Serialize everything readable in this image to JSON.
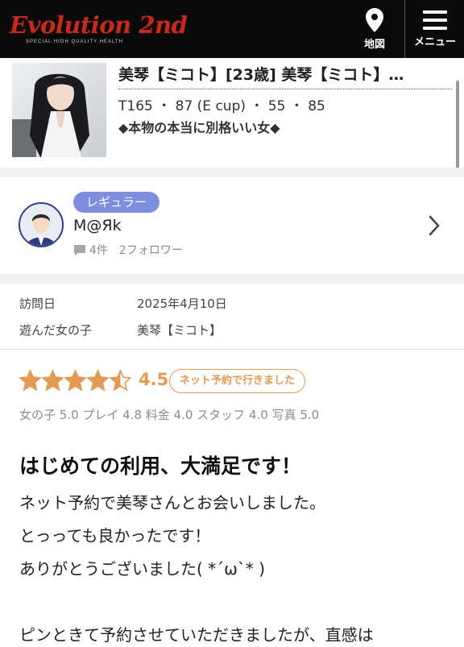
{
  "header": {
    "logo_main": "Evolution 2nd",
    "logo_sub": "SPECIAL HIGH QUALITY HEALTH",
    "map_icon": "map-pin-icon",
    "map_label": "地図",
    "menu_icon": "hamburger-menu-icon",
    "menu_label": "メニュー"
  },
  "cast": {
    "name": "美琴【ミコト】[23歳] 美琴【ミコト】…",
    "stats": "T165 ・ 87 (E cup) ・ 55 ・ 85",
    "catchphrase": "◆本物の本当に別格いい女◆"
  },
  "reviewer": {
    "badge": "レギュラー",
    "name": "M@Яk",
    "review_count": "4件",
    "followers": "2フォロワー"
  },
  "visit": {
    "date_label": "訪問日",
    "date_value": "2025年4月10日",
    "girl_label": "遊んだ女の子",
    "girl_value": "美琴【ミコト】"
  },
  "rating": {
    "score": "4.5",
    "score_value": 4.5,
    "stars_max": 5,
    "reservation_badge": "ネット予約で行きました",
    "subscores": "女の子 5.0 プレイ 4.8 料金 4.0 スタッフ 4.0 写真 5.0"
  },
  "review": {
    "title": "はじめての利用、大満足です！",
    "lines": [
      "ネット予約で美琴さんとお会いしました。",
      "とっっても良かったです！",
      "ありがとうございました( *´ω`* )",
      "",
      "ピンときて予約させていただきましたが、直感は"
    ]
  },
  "colors": {
    "header_bg": "#0a0a0a",
    "logo_red": "#c62a1e",
    "badge_purple": "#7f8edc",
    "rating_orange": "#e39a55"
  }
}
